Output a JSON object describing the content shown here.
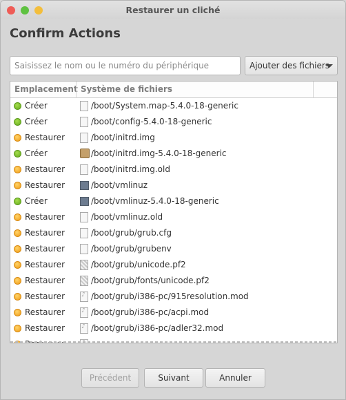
{
  "window": {
    "title": "Restaurer un cliché"
  },
  "heading": "Confirm Actions",
  "search": {
    "placeholder": "Saisissez le nom ou le numéro du périphérique"
  },
  "add_files": "Ajouter des fichiers",
  "table": {
    "headers": [
      "Emplacement",
      "Système de fichiers"
    ],
    "rows": [
      {
        "status": "green",
        "action": "Créer",
        "icon": "document-icon",
        "path": "/boot/System.map-5.4.0-18-generic"
      },
      {
        "status": "green",
        "action": "Créer",
        "icon": "document-icon",
        "path": "/boot/config-5.4.0-18-generic"
      },
      {
        "status": "orange",
        "action": "Restaurer",
        "icon": "document-icon",
        "path": "/boot/initrd.img"
      },
      {
        "status": "green",
        "action": "Créer",
        "icon": "package-icon",
        "path": "/boot/initrd.img-5.4.0-18-generic"
      },
      {
        "status": "orange",
        "action": "Restaurer",
        "icon": "document-icon",
        "path": "/boot/initrd.img.old"
      },
      {
        "status": "orange",
        "action": "Restaurer",
        "icon": "binary-icon",
        "path": "/boot/vmlinuz"
      },
      {
        "status": "green",
        "action": "Créer",
        "icon": "binary-icon",
        "path": "/boot/vmlinuz-5.4.0-18-generic"
      },
      {
        "status": "orange",
        "action": "Restaurer",
        "icon": "document-icon",
        "path": "/boot/vmlinuz.old"
      },
      {
        "status": "orange",
        "action": "Restaurer",
        "icon": "document-icon",
        "path": "/boot/grub/grub.cfg"
      },
      {
        "status": "orange",
        "action": "Restaurer",
        "icon": "document-icon",
        "path": "/boot/grub/grubenv"
      },
      {
        "status": "orange",
        "action": "Restaurer",
        "icon": "font-icon",
        "path": "/boot/grub/unicode.pf2"
      },
      {
        "status": "orange",
        "action": "Restaurer",
        "icon": "font-icon",
        "path": "/boot/grub/fonts/unicode.pf2"
      },
      {
        "status": "orange",
        "action": "Restaurer",
        "icon": "module-icon",
        "path": "/boot/grub/i386-pc/915resolution.mod"
      },
      {
        "status": "orange",
        "action": "Restaurer",
        "icon": "module-icon",
        "path": "/boot/grub/i386-pc/acpi.mod"
      },
      {
        "status": "orange",
        "action": "Restaurer",
        "icon": "module-icon",
        "path": "/boot/grub/i386-pc/adler32.mod"
      },
      {
        "status": "orange",
        "action": "Restaurer",
        "icon": "module-icon",
        "path": ""
      }
    ]
  },
  "buttons": {
    "previous": "Précédent",
    "next": "Suivant",
    "cancel": "Annuler"
  },
  "colors": {
    "create": "#62a91a",
    "restore": "#f09a14"
  }
}
